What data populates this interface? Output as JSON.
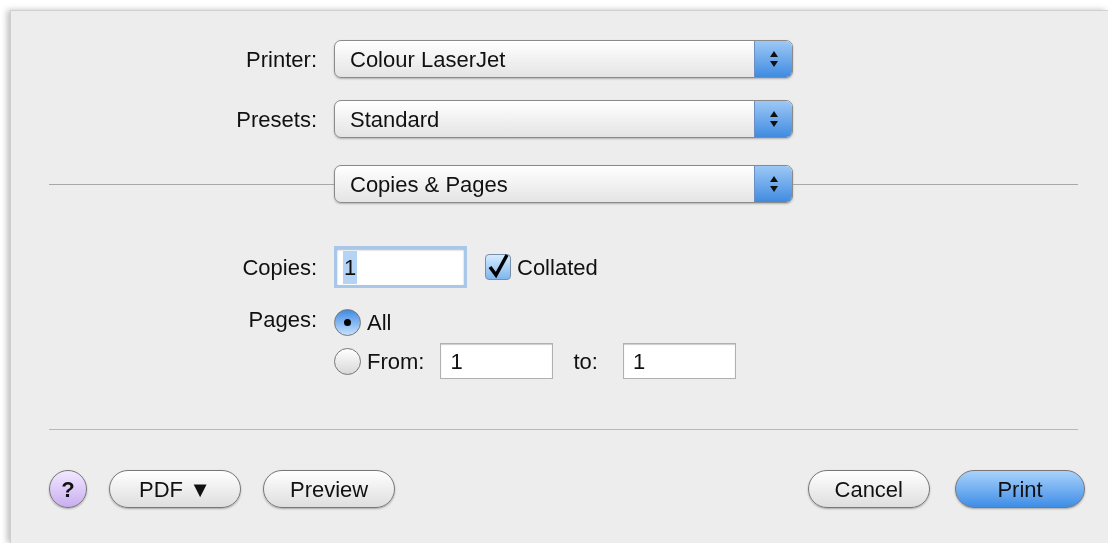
{
  "popups": [
    {
      "label": "Printer:",
      "value": "Colour LaserJet"
    },
    {
      "label": "Presets:",
      "value": "Standard"
    }
  ],
  "section_popup": {
    "value": "Copies & Pages"
  },
  "copies": {
    "label": "Copies:",
    "value": "1",
    "collated": {
      "label": "Collated",
      "checked": true
    }
  },
  "pages": {
    "label": "Pages:",
    "options": [
      {
        "kind": "all",
        "label": "All",
        "selected": true
      },
      {
        "kind": "range",
        "label": "From:",
        "selected": false,
        "from": "1",
        "to_label": "to:",
        "to": "1"
      }
    ]
  },
  "buttons": [
    {
      "kind": "help",
      "label": "?"
    },
    {
      "kind": "menu",
      "label": "PDF ▼"
    },
    {
      "kind": "plain",
      "label": "Preview"
    },
    {
      "kind": "spacer"
    },
    {
      "kind": "plain",
      "label": "Cancel"
    },
    {
      "kind": "default",
      "label": "Print"
    }
  ]
}
